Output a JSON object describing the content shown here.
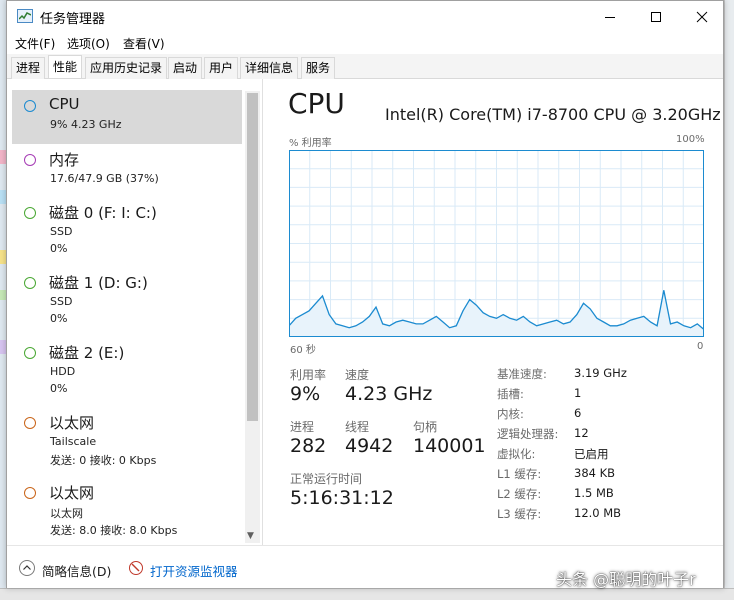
{
  "window": {
    "title": "任务管理器"
  },
  "menu": {
    "file": "文件(F)",
    "options": "选项(O)",
    "view": "查看(V)"
  },
  "tabs": [
    {
      "label": "进程"
    },
    {
      "label": "性能"
    },
    {
      "label": "应用历史记录"
    },
    {
      "label": "启动"
    },
    {
      "label": "用户"
    },
    {
      "label": "详细信息"
    },
    {
      "label": "服务"
    }
  ],
  "sidebar": {
    "items": [
      {
        "title": "CPU",
        "line1": "9% 4.23 GHz",
        "color": "#1c8bd0"
      },
      {
        "title": "内存",
        "line1": "17.6/47.9 GB (37%)",
        "color": "#a63cb5"
      },
      {
        "title": "磁盘 0 (F: I: C:)",
        "line1": "SSD",
        "line2": "0%",
        "color": "#4aa834"
      },
      {
        "title": "磁盘 1 (D: G:)",
        "line1": "SSD",
        "line2": "0%",
        "color": "#4aa834"
      },
      {
        "title": "磁盘 2 (E:)",
        "line1": "HDD",
        "line2": "0%",
        "color": "#4aa834"
      },
      {
        "title": "以太网",
        "line1": "Tailscale",
        "line2": "发送: 0 接收: 0 Kbps",
        "color": "#c9651a"
      },
      {
        "title": "以太网",
        "line1": "以太网",
        "line2": "发送: 8.0 接收: 8.0 Kbps",
        "color": "#c9651a"
      }
    ]
  },
  "cpu": {
    "title": "CPU",
    "model": "Intel(R) Core(TM) i7-8700 CPU @ 3.20GHz",
    "graph_label": "% 利用率",
    "graph_max": "100%",
    "graph_time": "60 秒",
    "graph_zero": "0",
    "graph_color": "#1c8bd0",
    "utilization_series": [
      6,
      10,
      12,
      14,
      18,
      22,
      12,
      7,
      6,
      5,
      6,
      8,
      11,
      16,
      7,
      6,
      8,
      9,
      8,
      7,
      7,
      9,
      11,
      8,
      5,
      6,
      14,
      20,
      17,
      13,
      11,
      10,
      12,
      10,
      9,
      11,
      8,
      6,
      7,
      8,
      9,
      7,
      8,
      12,
      18,
      15,
      10,
      8,
      6,
      6,
      7,
      9,
      10,
      11,
      8,
      6,
      25,
      7,
      8,
      6,
      5,
      7,
      4
    ],
    "stats": {
      "utilization_label": "利用率",
      "utilization": "9%",
      "speed_label": "速度",
      "speed": "4.23 GHz",
      "processes_label": "进程",
      "processes": "282",
      "threads_label": "线程",
      "threads": "4942",
      "handles_label": "句柄",
      "handles": "140001",
      "uptime_label": "正常运行时间",
      "uptime": "5:16:31:12"
    },
    "details": [
      {
        "label": "基准速度:",
        "value": "3.19 GHz"
      },
      {
        "label": "插槽:",
        "value": "1"
      },
      {
        "label": "内核:",
        "value": "6"
      },
      {
        "label": "逻辑处理器:",
        "value": "12"
      },
      {
        "label": "虚拟化:",
        "value": "已启用"
      },
      {
        "label": "L1 缓存:",
        "value": "384 KB"
      },
      {
        "label": "L2 缓存:",
        "value": "1.5 MB"
      },
      {
        "label": "L3 缓存:",
        "value": "12.0 MB"
      }
    ]
  },
  "footer": {
    "collapse": "简略信息(D)",
    "monitor": "打开资源监视器"
  },
  "watermark": "头条 @聪明的叶子r"
}
